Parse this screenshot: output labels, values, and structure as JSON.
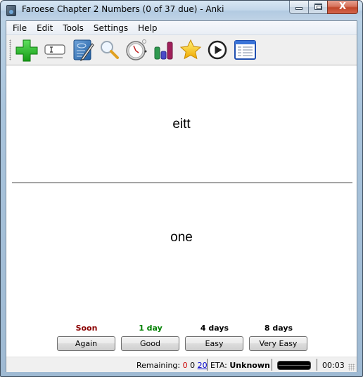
{
  "window": {
    "title": "Faroese Chapter 2 Numbers (0 of 37 due) - Anki",
    "controls": {
      "minimize": "minimize",
      "maximize": "maximize",
      "close": "X"
    }
  },
  "menubar": {
    "items": [
      "File",
      "Edit",
      "Tools",
      "Settings",
      "Help"
    ]
  },
  "toolbar": {
    "buttons": [
      {
        "icon": "add-icon",
        "label": "Add Items"
      },
      {
        "icon": "edit-current-icon",
        "label": "Edit Current"
      },
      {
        "icon": "browse-icon",
        "label": "Browse Items"
      },
      {
        "icon": "search-icon",
        "label": "Find"
      },
      {
        "icon": "timer-icon",
        "label": "Timebox"
      },
      {
        "icon": "statistics-icon",
        "label": "Statistics"
      },
      {
        "icon": "star-icon",
        "label": "Mark"
      },
      {
        "icon": "play-icon",
        "label": "Replay Audio"
      },
      {
        "icon": "list-icon",
        "label": "Card Info"
      }
    ]
  },
  "card": {
    "question": "eitt",
    "answer": "one"
  },
  "answer_buttons": [
    {
      "interval": "Soon",
      "interval_color": "#8b0000",
      "label": "Again"
    },
    {
      "interval": "1 day",
      "interval_color": "#008000",
      "label": "Good"
    },
    {
      "interval": "4 days",
      "interval_color": "#000000",
      "label": "Easy"
    },
    {
      "interval": "8 days",
      "interval_color": "#000000",
      "label": "Very Easy"
    }
  ],
  "statusbar": {
    "remaining_label": "Remaining:",
    "remaining_new": "0",
    "remaining_review": "0",
    "remaining_total": "20",
    "eta_label": "ETA:",
    "eta_value": "Unknown",
    "timer": "00:03"
  }
}
